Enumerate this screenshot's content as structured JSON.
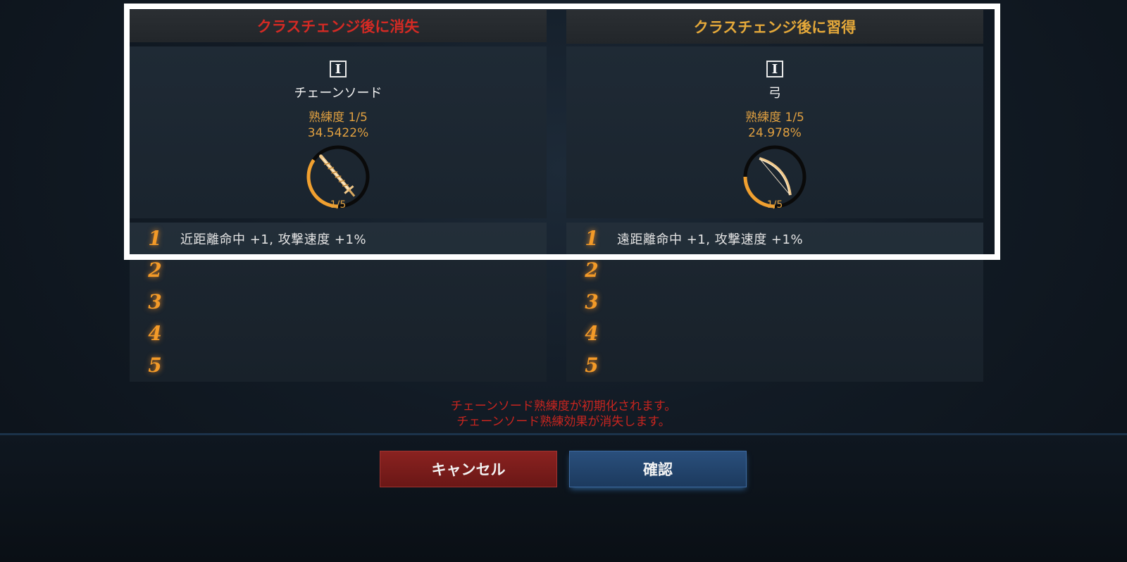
{
  "left_panel": {
    "header": "クラスチェンジ後に消失",
    "tier": "I",
    "weapon_name": "チェーンソード",
    "mastery": "熟練度 1/5",
    "percent": "34.5422%",
    "progress": 0.345422,
    "level": "1/5",
    "icon": "chain-sword-icon",
    "effects": [
      {
        "num": "1",
        "text": "近距離命中 +1, 攻撃速度 +1%"
      },
      {
        "num": "2",
        "text": ""
      },
      {
        "num": "3",
        "text": ""
      },
      {
        "num": "4",
        "text": ""
      },
      {
        "num": "5",
        "text": ""
      }
    ]
  },
  "right_panel": {
    "header": "クラスチェンジ後に習得",
    "tier": "I",
    "weapon_name": "弓",
    "mastery": "熟練度 1/5",
    "percent": "24.978%",
    "progress": 0.24978,
    "level": "1/5",
    "icon": "bow-icon",
    "effects": [
      {
        "num": "1",
        "text": "遠距離命中 +1, 攻撃速度 +1%"
      },
      {
        "num": "2",
        "text": ""
      },
      {
        "num": "3",
        "text": ""
      },
      {
        "num": "4",
        "text": ""
      },
      {
        "num": "5",
        "text": ""
      }
    ]
  },
  "warning": {
    "line1": "チェーンソード熟練度が初期化されます。",
    "line2": "チェーンソード熟練効果が消失します。"
  },
  "buttons": {
    "cancel": "キャンセル",
    "confirm": "確認"
  },
  "colors": {
    "lost": "#d42a24",
    "gain": "#e5a93a",
    "accent_orange": "#f39a28"
  }
}
